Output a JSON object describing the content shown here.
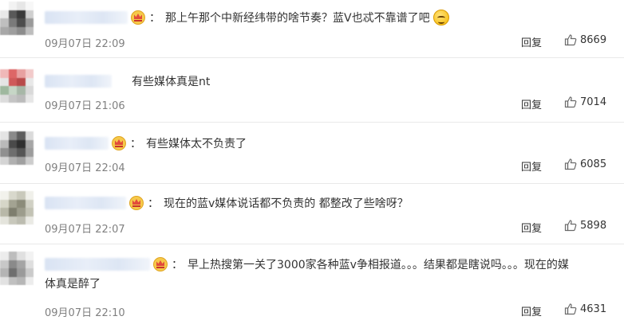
{
  "labels": {
    "reply": "回复"
  },
  "colors": {
    "accent_link": "#333333",
    "meta_gray": "#808080",
    "divider": "#e9e9e9",
    "crown": "#f6c94a"
  },
  "comments": [
    {
      "text": "那上午那个中新经纬带的啥节奏？蓝V也忒不靠谱了吧",
      "text_line2": "",
      "timestamp": "09月07日 22:09",
      "likes": "8669",
      "has_crown": true,
      "has_emoji": true
    },
    {
      "text": "有些媒体真是nt",
      "text_line2": "",
      "timestamp": "09月07日 21:06",
      "likes": "7014",
      "has_crown": false,
      "has_emoji": false
    },
    {
      "text": "有些媒体太不负责了",
      "text_line2": "",
      "timestamp": "09月07日 22:04",
      "likes": "6085",
      "has_crown": true,
      "has_emoji": false
    },
    {
      "text": "现在的蓝v媒体说话都不负责的 都整改了些啥呀？",
      "text_line2": "",
      "timestamp": "09月07日 22:07",
      "likes": "5898",
      "has_crown": true,
      "has_emoji": false
    },
    {
      "text": "早上热搜第一关了3000家各种蓝v争相报道。。。结果都是瞎说吗。。。现在的媒",
      "text_line2": "体真是醉了",
      "timestamp": "09月07日 22:10",
      "likes": "4631",
      "has_crown": true,
      "has_emoji": false
    }
  ]
}
